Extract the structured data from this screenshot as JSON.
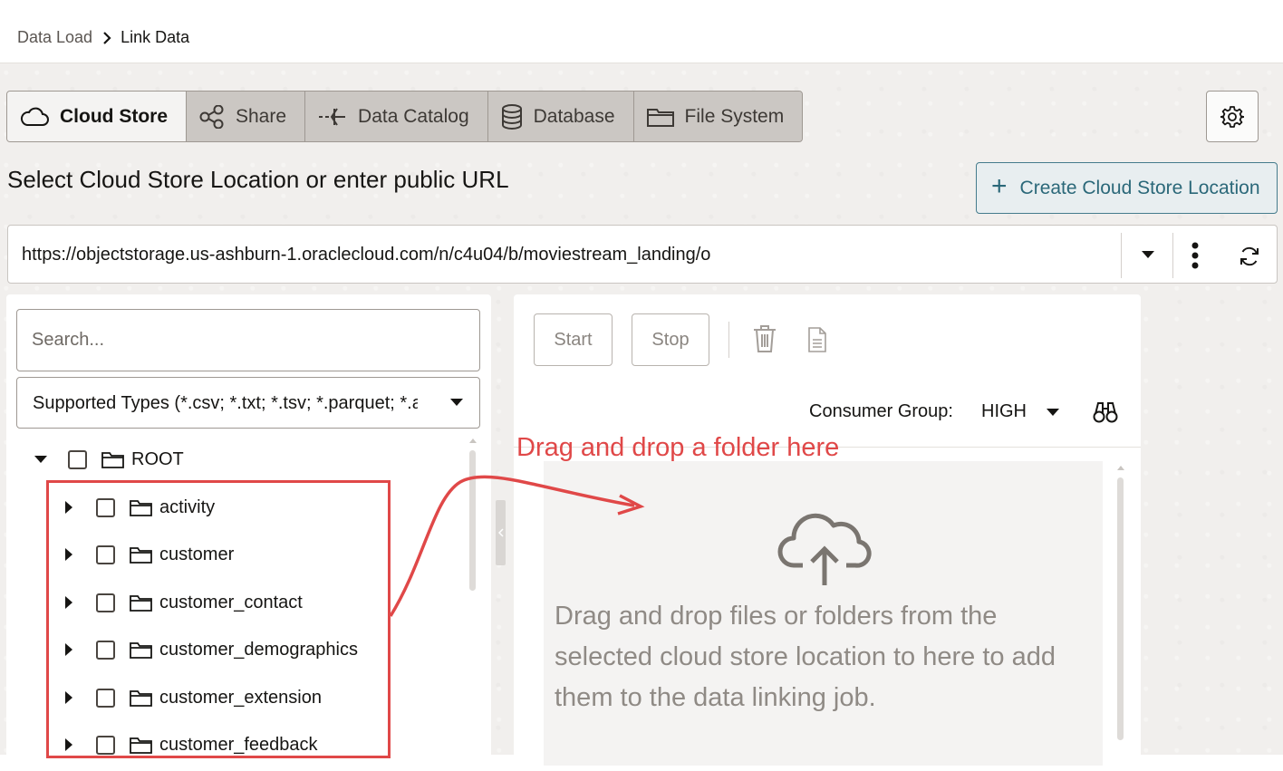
{
  "breadcrumb": {
    "parent": "Data Load",
    "current": "Link Data"
  },
  "tabs": [
    {
      "label": "Cloud Store",
      "icon": "cloud-icon",
      "active": true
    },
    {
      "label": "Share",
      "icon": "share-icon",
      "active": false
    },
    {
      "label": "Data Catalog",
      "icon": "data-catalog-icon",
      "active": false
    },
    {
      "label": "Database",
      "icon": "database-icon",
      "active": false
    },
    {
      "label": "File System",
      "icon": "folder-icon",
      "active": false
    }
  ],
  "section": {
    "title": "Select Cloud Store Location or enter public URL"
  },
  "create_button": {
    "label": "Create Cloud Store Location"
  },
  "url_bar": {
    "value": "https://objectstorage.us-ashburn-1.oraclecloud.com/n/c4u04/b/moviestream_landing/o"
  },
  "left_panel": {
    "search_placeholder": "Search...",
    "types_filter": "Supported Types (*.csv; *.txt; *.tsv; *.parquet; *.avro; *.orc; *.json)",
    "root_label": "ROOT",
    "folders": [
      "activity",
      "customer",
      "customer_contact",
      "customer_demographics",
      "customer_extension",
      "customer_feedback"
    ]
  },
  "toolbar": {
    "start_label": "Start",
    "stop_label": "Stop"
  },
  "consumer_group": {
    "label": "Consumer Group:",
    "value": "HIGH"
  },
  "dropzone": {
    "text": "Drag and drop files or folders from the selected cloud store location to here to add them to the data linking job."
  },
  "annotation": {
    "text": "Drag and drop a folder here",
    "color": "#e04848"
  },
  "colors": {
    "accent": "#2b6879",
    "annotation": "#e04848"
  }
}
